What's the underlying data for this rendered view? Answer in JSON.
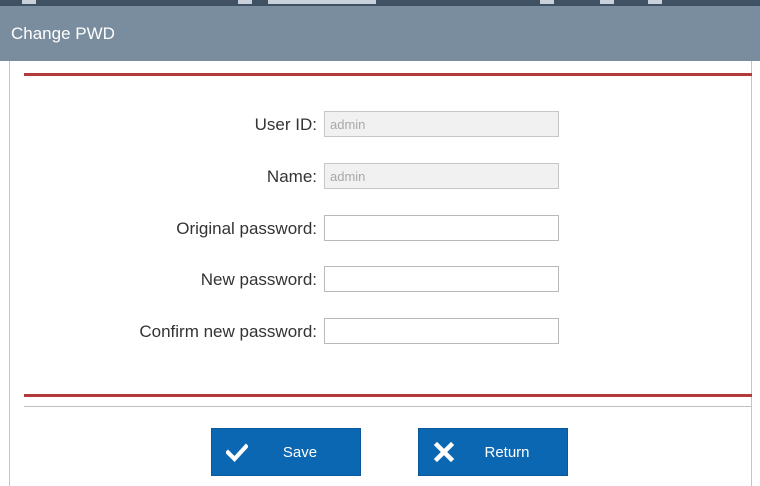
{
  "dialog": {
    "title": "Change PWD"
  },
  "form": {
    "user_id": {
      "label": "User ID:",
      "value": "admin"
    },
    "name": {
      "label": "Name:",
      "value": "admin"
    },
    "original_password": {
      "label": "Original password:",
      "value": ""
    },
    "new_password": {
      "label": "New password:",
      "value": ""
    },
    "confirm_password": {
      "label": "Confirm new password:",
      "value": ""
    }
  },
  "buttons": {
    "save": {
      "label": "Save",
      "icon": "checkmark-icon"
    },
    "return": {
      "label": "Return",
      "icon": "close-icon"
    }
  },
  "colors": {
    "titlebar": "#798d9f",
    "accent_line": "#b23a3a",
    "button": "#0b67b2"
  }
}
